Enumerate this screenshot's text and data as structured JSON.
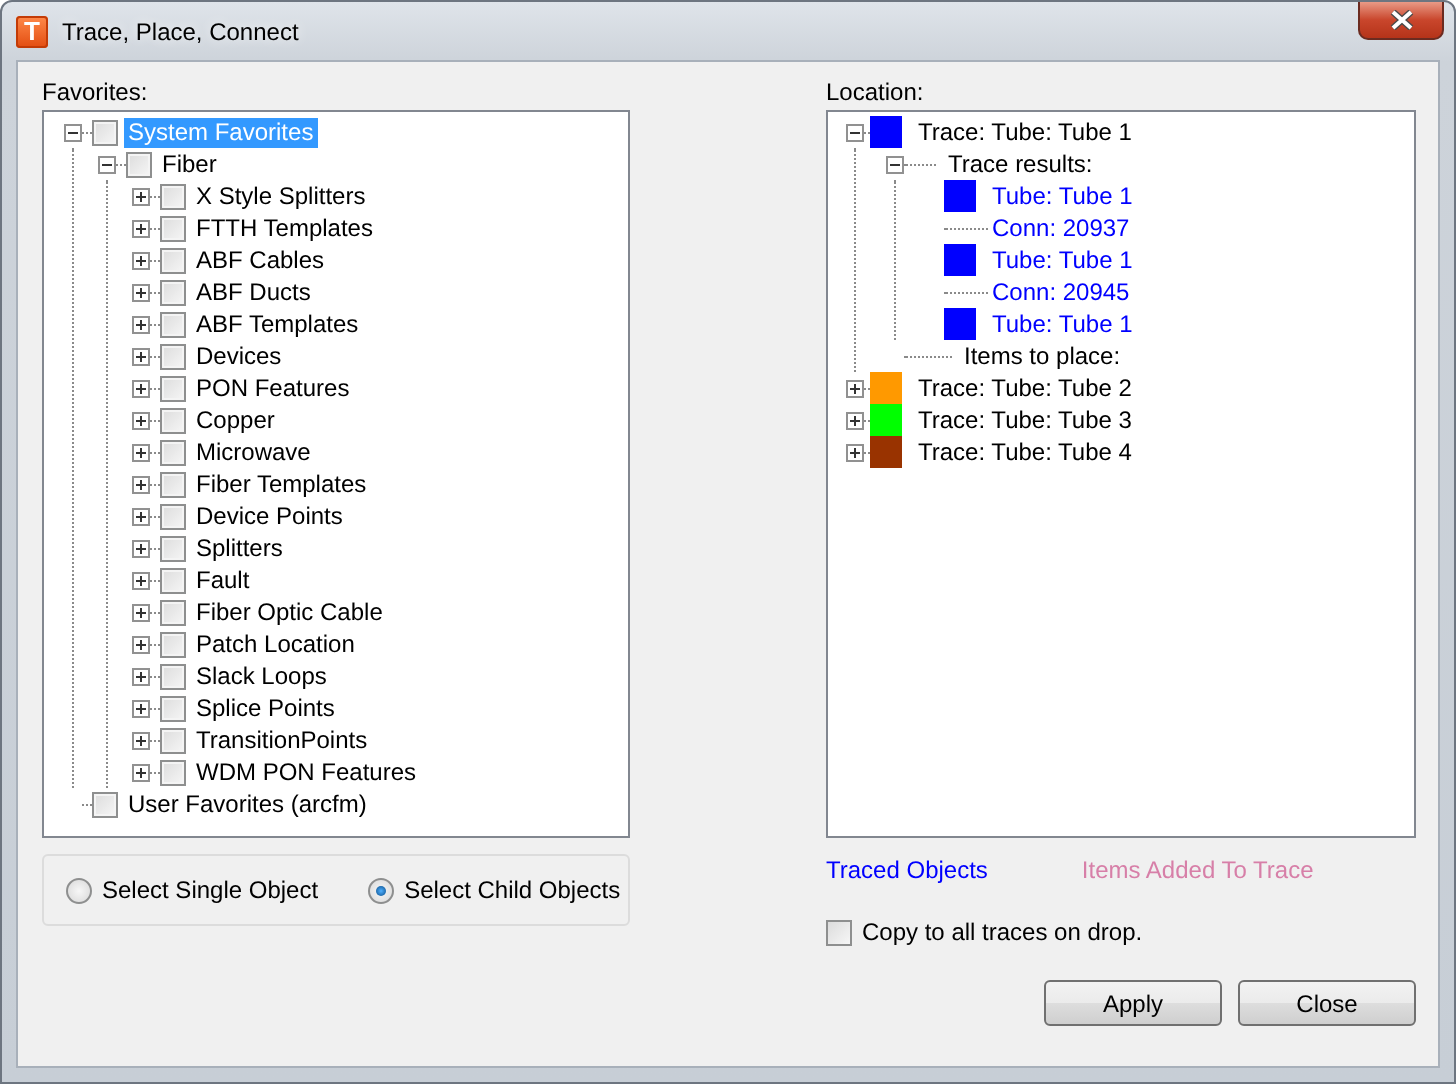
{
  "window": {
    "icon_letter": "T",
    "title": "Trace, Place, Connect"
  },
  "favorites": {
    "label": "Favorites:",
    "items": [
      {
        "label": "System Favorites",
        "checked": false,
        "selected": true,
        "expanded": true,
        "children": [
          {
            "label": "Fiber",
            "checked": false,
            "selected": false,
            "expanded": true,
            "children": [
              {
                "label": "X Style Splitters",
                "checked": false,
                "selected": false,
                "expanded": false
              },
              {
                "label": "FTTH Templates",
                "checked": false,
                "selected": false,
                "expanded": false
              },
              {
                "label": "ABF Cables",
                "checked": false,
                "selected": false,
                "expanded": false
              },
              {
                "label": "ABF Ducts",
                "checked": false,
                "selected": false,
                "expanded": false
              },
              {
                "label": "ABF Templates",
                "checked": false,
                "selected": false,
                "expanded": false
              },
              {
                "label": "Devices",
                "checked": false,
                "selected": false,
                "expanded": false
              },
              {
                "label": "PON Features",
                "checked": false,
                "selected": false,
                "expanded": false
              },
              {
                "label": "Copper",
                "checked": false,
                "selected": false,
                "expanded": false
              },
              {
                "label": "Microwave",
                "checked": false,
                "selected": false,
                "expanded": false
              },
              {
                "label": "Fiber Templates",
                "checked": false,
                "selected": false,
                "expanded": false
              },
              {
                "label": "Device Points",
                "checked": false,
                "selected": false,
                "expanded": false
              },
              {
                "label": "Splitters",
                "checked": false,
                "selected": false,
                "expanded": false
              },
              {
                "label": "Fault",
                "checked": false,
                "selected": false,
                "expanded": false
              },
              {
                "label": "Fiber Optic Cable",
                "checked": false,
                "selected": false,
                "expanded": false
              },
              {
                "label": "Patch Location",
                "checked": false,
                "selected": false,
                "expanded": false
              },
              {
                "label": "Slack Loops",
                "checked": false,
                "selected": false,
                "expanded": false
              },
              {
                "label": "Splice Points",
                "checked": false,
                "selected": false,
                "expanded": false
              },
              {
                "label": "TransitionPoints",
                "checked": false,
                "selected": false,
                "expanded": false
              },
              {
                "label": "WDM PON Features",
                "checked": false,
                "selected": false,
                "expanded": false
              }
            ]
          }
        ]
      },
      {
        "label": "User Favorites (arcfm)",
        "checked": false,
        "selected": false
      }
    ]
  },
  "selection_mode": [
    {
      "label": "Select Single Object",
      "selected": false
    },
    {
      "label": "Select Child Objects",
      "selected": true
    }
  ],
  "location": {
    "label": "Location:",
    "items": [
      {
        "kind": "trace",
        "label": "Trace: Tube: Tube 1",
        "color": "#0000ff",
        "expanded": true,
        "children": [
          {
            "kind": "group",
            "label": "Trace results:",
            "expanded": true,
            "children": [
              {
                "kind": "result",
                "label": "Tube: Tube 1",
                "color": "#0000ff"
              },
              {
                "kind": "result",
                "label": "Conn: 20937"
              },
              {
                "kind": "result",
                "label": "Tube: Tube 1",
                "color": "#0000ff"
              },
              {
                "kind": "result",
                "label": "Conn: 20945"
              },
              {
                "kind": "result",
                "label": "Tube: Tube 1",
                "color": "#0000ff"
              }
            ]
          },
          {
            "kind": "group",
            "label": "Items to place:"
          }
        ]
      },
      {
        "kind": "trace",
        "label": "Trace: Tube: Tube 2",
        "color": "#ff9900",
        "expanded": false
      },
      {
        "kind": "trace",
        "label": "Trace: Tube: Tube 3",
        "color": "#00ff00",
        "expanded": false
      },
      {
        "kind": "trace",
        "label": "Trace: Tube: Tube 4",
        "color": "#993300",
        "expanded": false
      }
    ]
  },
  "legend": [
    {
      "label": "Traced Objects",
      "color": "#0000ff"
    },
    {
      "label": "Items Added To Trace",
      "color": "#d77fa8"
    }
  ],
  "copy_to_all": {
    "label": "Copy to all traces on drop.",
    "checked": false
  },
  "buttons": [
    "Apply",
    "Close"
  ]
}
